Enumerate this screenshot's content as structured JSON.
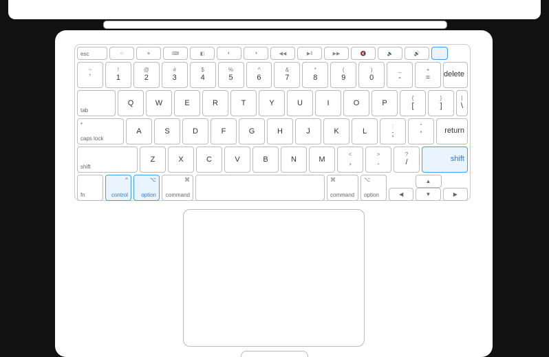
{
  "fnrow": [
    "esc",
    "☼",
    "☀",
    "⌨",
    "◧",
    "◐",
    "◑",
    "◀◀",
    "▶‖",
    "▶▶",
    "🔇",
    "🔉",
    "🔊",
    ""
  ],
  "r1upper": [
    "!",
    "@",
    "#",
    "$",
    "%",
    "^",
    "&",
    "*",
    "(",
    ")",
    "_",
    "+"
  ],
  "r1lower": [
    "1",
    "2",
    "3",
    "4",
    "5",
    "6",
    "7",
    "8",
    "9",
    "0",
    "-",
    "="
  ],
  "r1left": "`",
  "delete": "delete",
  "tab": "tab",
  "r2": [
    "Q",
    "W",
    "E",
    "R",
    "T",
    "Y",
    "U",
    "I",
    "O",
    "P"
  ],
  "r2b": [
    [
      "{",
      "["
    ],
    [
      "}",
      "]"
    ],
    [
      "|",
      "\\"
    ]
  ],
  "caps": "caps lock",
  "r3": [
    "A",
    "S",
    "D",
    "F",
    "G",
    "H",
    "J",
    "K",
    "L"
  ],
  "r3b": [
    [
      ":",
      ";"
    ],
    [
      "\"",
      "'"
    ]
  ],
  "return": "return",
  "shiftL": "shift",
  "r4": [
    "Z",
    "X",
    "C",
    "V",
    "B",
    "N",
    "M"
  ],
  "r4b": [
    [
      "<",
      ","
    ],
    [
      ">",
      "."
    ],
    [
      "?",
      "/"
    ]
  ],
  "shiftR": "shift",
  "fn": "fn",
  "control": "control",
  "option": "option",
  "command": "command",
  "optSym": "⌥",
  "cmdSym": "⌘",
  "ctrlSym": "^",
  "arrows": {
    "up": "▲",
    "left": "◀",
    "down": "▼",
    "right": "▶"
  }
}
